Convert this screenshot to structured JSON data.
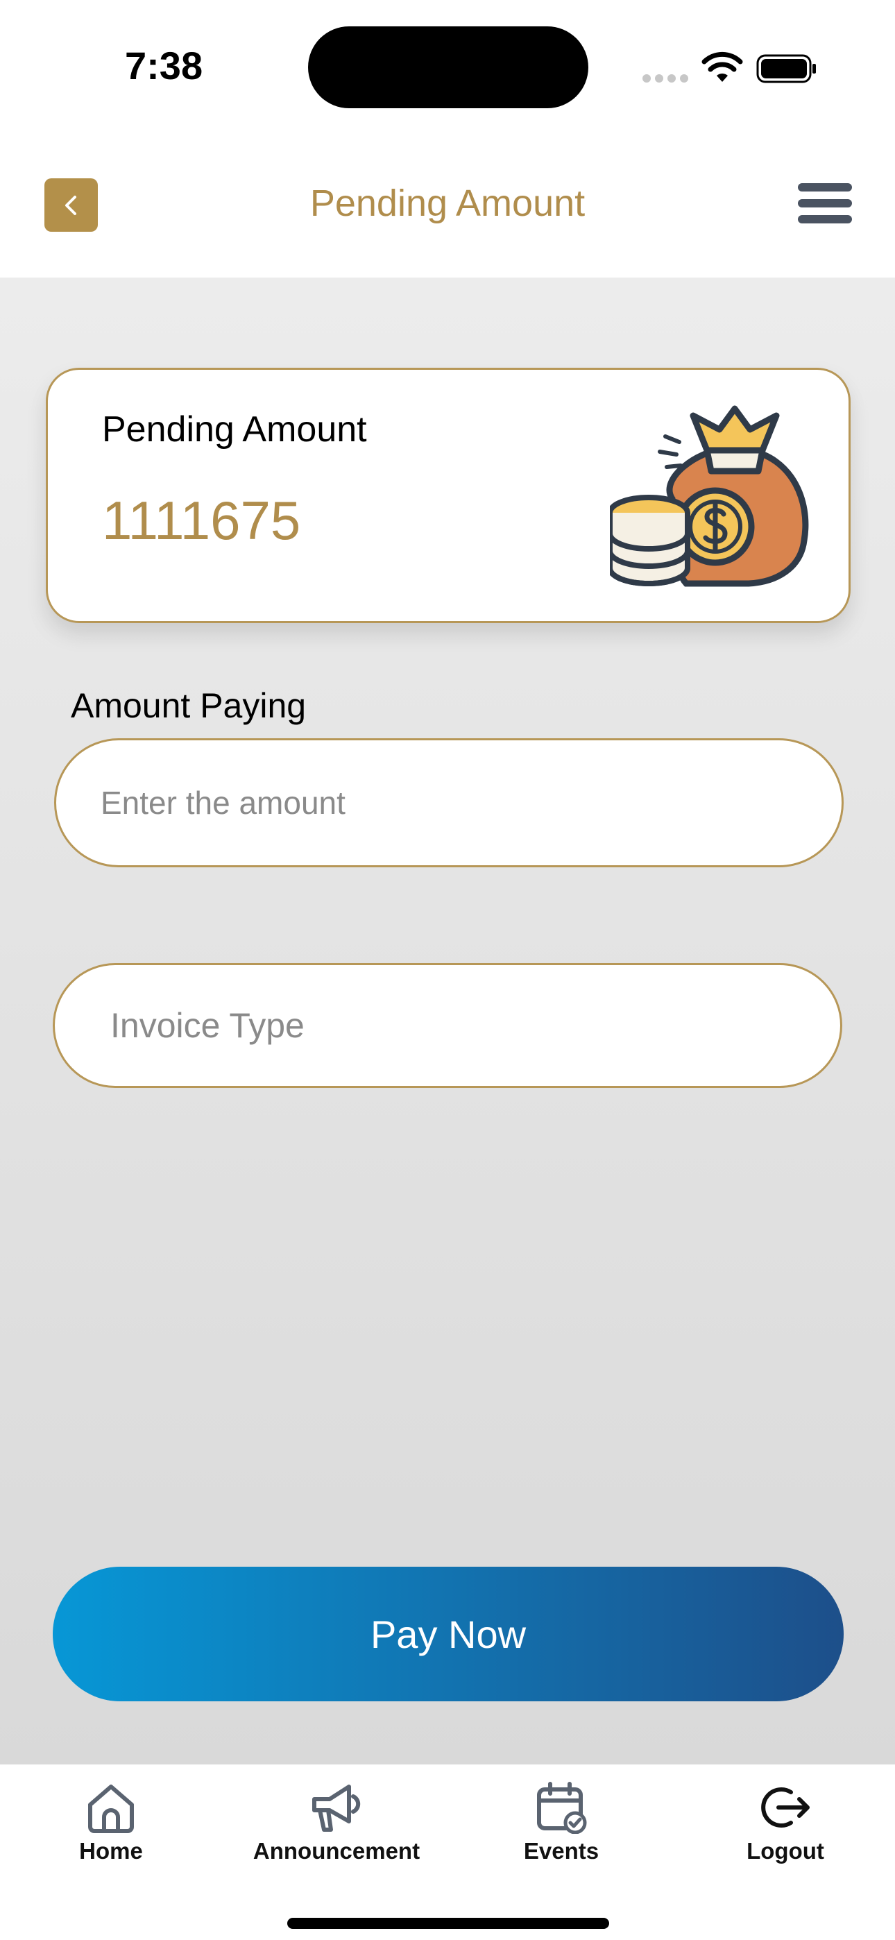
{
  "status_bar": {
    "time": "7:38"
  },
  "header": {
    "title": "Pending Amount"
  },
  "pending_card": {
    "label": "Pending Amount",
    "amount": "1111675"
  },
  "form": {
    "amount_label": "Amount Paying",
    "amount_value": "",
    "amount_placeholder": "Enter the amount",
    "invoice_value": "",
    "invoice_placeholder": "Invoice Type"
  },
  "pay_button": {
    "label": "Pay Now"
  },
  "tabbar": {
    "items": [
      {
        "label": "Home",
        "icon": "home-icon"
      },
      {
        "label": "Announcement",
        "icon": "megaphone-icon"
      },
      {
        "label": "Events",
        "icon": "calendar-check-icon"
      },
      {
        "label": "Logout",
        "icon": "logout-icon"
      }
    ]
  },
  "colors": {
    "accent_gold": "#b08d4c",
    "card_border": "#b79757",
    "button_gradient_start": "#0797d6",
    "button_gradient_end": "#1d4f8a",
    "icon_gray": "#4a5361"
  }
}
